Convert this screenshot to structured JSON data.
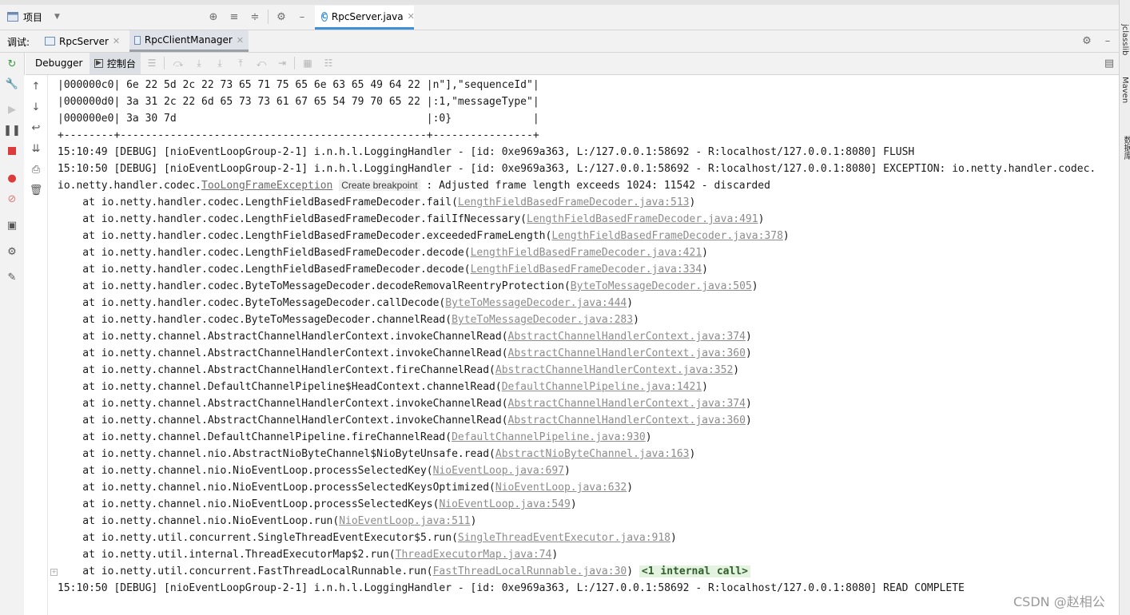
{
  "top": {
    "project_label": "项目",
    "editor_tab": "RpcServer.java",
    "editor_tab_badge": "C"
  },
  "debug": {
    "label": "调试:",
    "sessions": [
      "RpcServer",
      "RpcClientManager"
    ]
  },
  "subtoolbar": {
    "debugger_tab": "Debugger",
    "console_tab": "控制台"
  },
  "right_panel": {
    "jclasslib": "jclasslib",
    "maven": "Maven",
    "database": "数据库"
  },
  "console": {
    "lines": [
      "|000000c0| 6e 22 5d 2c 22 73 65 71 75 65 6e 63 65 49 64 22 |n\"],\"sequenceId\"|",
      "|000000d0| 3a 31 2c 22 6d 65 73 73 61 67 65 54 79 70 65 22 |:1,\"messageType\"|",
      "|000000e0| 3a 30 7d                                        |:0}             |",
      "+--------+-------------------------------------------------+----------------+",
      "15:10:49 [DEBUG] [nioEventLoopGroup-2-1] i.n.h.l.LoggingHandler - [id: 0xe969a363, L:/127.0.0.1:58692 - R:localhost/127.0.0.1:8080] FLUSH",
      "15:10:50 [DEBUG] [nioEventLoopGroup-2-1] i.n.h.l.LoggingHandler - [id: 0xe969a363, L:/127.0.0.1:58692 - R:localhost/127.0.0.1:8080] EXCEPTION: io.netty.handler.codec."
    ],
    "exception": {
      "prefix": "io.netty.handler.codec.",
      "class_link": "TooLongFrameException",
      "hint": "Create breakpoint",
      "message": " : Adjusted frame length exceeds 1024: 11542 - discarded"
    },
    "stack": [
      {
        "m": "    at io.netty.handler.codec.LengthFieldBasedFrameDecoder.fail(",
        "l": "LengthFieldBasedFrameDecoder.java:513",
        "s": ")"
      },
      {
        "m": "    at io.netty.handler.codec.LengthFieldBasedFrameDecoder.failIfNecessary(",
        "l": "LengthFieldBasedFrameDecoder.java:491",
        "s": ")"
      },
      {
        "m": "    at io.netty.handler.codec.LengthFieldBasedFrameDecoder.exceededFrameLength(",
        "l": "LengthFieldBasedFrameDecoder.java:378",
        "s": ")"
      },
      {
        "m": "    at io.netty.handler.codec.LengthFieldBasedFrameDecoder.decode(",
        "l": "LengthFieldBasedFrameDecoder.java:421",
        "s": ")"
      },
      {
        "m": "    at io.netty.handler.codec.LengthFieldBasedFrameDecoder.decode(",
        "l": "LengthFieldBasedFrameDecoder.java:334",
        "s": ")"
      },
      {
        "m": "    at io.netty.handler.codec.ByteToMessageDecoder.decodeRemovalReentryProtection(",
        "l": "ByteToMessageDecoder.java:505",
        "s": ")"
      },
      {
        "m": "    at io.netty.handler.codec.ByteToMessageDecoder.callDecode(",
        "l": "ByteToMessageDecoder.java:444",
        "s": ")"
      },
      {
        "m": "    at io.netty.handler.codec.ByteToMessageDecoder.channelRead(",
        "l": "ByteToMessageDecoder.java:283",
        "s": ")"
      },
      {
        "m": "    at io.netty.channel.AbstractChannelHandlerContext.invokeChannelRead(",
        "l": "AbstractChannelHandlerContext.java:374",
        "s": ")"
      },
      {
        "m": "    at io.netty.channel.AbstractChannelHandlerContext.invokeChannelRead(",
        "l": "AbstractChannelHandlerContext.java:360",
        "s": ")"
      },
      {
        "m": "    at io.netty.channel.AbstractChannelHandlerContext.fireChannelRead(",
        "l": "AbstractChannelHandlerContext.java:352",
        "s": ")"
      },
      {
        "m": "    at io.netty.channel.DefaultChannelPipeline$HeadContext.channelRead(",
        "l": "DefaultChannelPipeline.java:1421",
        "s": ")"
      },
      {
        "m": "    at io.netty.channel.AbstractChannelHandlerContext.invokeChannelRead(",
        "l": "AbstractChannelHandlerContext.java:374",
        "s": ")"
      },
      {
        "m": "    at io.netty.channel.AbstractChannelHandlerContext.invokeChannelRead(",
        "l": "AbstractChannelHandlerContext.java:360",
        "s": ")"
      },
      {
        "m": "    at io.netty.channel.DefaultChannelPipeline.fireChannelRead(",
        "l": "DefaultChannelPipeline.java:930",
        "s": ")"
      },
      {
        "m": "    at io.netty.channel.nio.AbstractNioByteChannel$NioByteUnsafe.read(",
        "l": "AbstractNioByteChannel.java:163",
        "s": ")"
      },
      {
        "m": "    at io.netty.channel.nio.NioEventLoop.processSelectedKey(",
        "l": "NioEventLoop.java:697",
        "s": ")"
      },
      {
        "m": "    at io.netty.channel.nio.NioEventLoop.processSelectedKeysOptimized(",
        "l": "NioEventLoop.java:632",
        "s": ")"
      },
      {
        "m": "    at io.netty.channel.nio.NioEventLoop.processSelectedKeys(",
        "l": "NioEventLoop.java:549",
        "s": ")"
      },
      {
        "m": "    at io.netty.channel.nio.NioEventLoop.run(",
        "l": "NioEventLoop.java:511",
        "s": ")"
      },
      {
        "m": "    at io.netty.util.concurrent.SingleThreadEventExecutor$5.run(",
        "l": "SingleThreadEventExecutor.java:918",
        "s": ")"
      },
      {
        "m": "    at io.netty.util.internal.ThreadExecutorMap$2.run(",
        "l": "ThreadExecutorMap.java:74",
        "s": ")"
      },
      {
        "m": "    at io.netty.util.concurrent.FastThreadLocalRunnable.run(",
        "l": "FastThreadLocalRunnable.java:30",
        "s": ")"
      }
    ],
    "internal_call": "<1 internal call>",
    "last_line": "15:10:50 [DEBUG] [nioEventLoopGroup-2-1] i.n.h.l.LoggingHandler - [id: 0xe969a363, L:/127.0.0.1:58692 - R:localhost/127.0.0.1:8080] READ COMPLETE"
  },
  "watermark": "CSDN @赵相公",
  "icons": {
    "left_gutter": [
      "rerun-icon",
      "settings-wrench-icon",
      "resume-icon",
      "pause-icon",
      "stop-icon",
      "view-breakpoints-icon",
      "mute-breakpoints-icon",
      "screenshot-icon",
      "settings-icon",
      "pin-icon"
    ],
    "console_gutter": [
      "scroll-up-icon",
      "scroll-down-icon",
      "soft-wrap-icon",
      "scroll-to-end-icon",
      "print-icon",
      "clear-icon"
    ]
  }
}
